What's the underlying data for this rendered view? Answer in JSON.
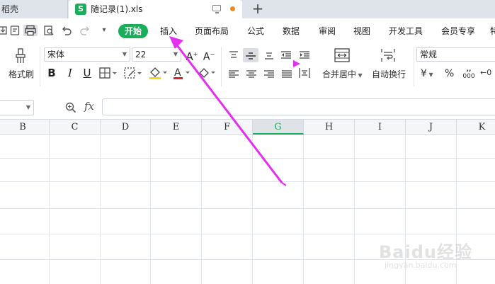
{
  "tabs": {
    "previous_label": "稻壳",
    "active_title": "随记录(1).xls",
    "logo_letter": "S",
    "new_tab_symbol": "+"
  },
  "menu": {
    "start": "开始",
    "items": [
      "插入",
      "页面布局",
      "公式",
      "数据",
      "审阅",
      "视图",
      "开发工具",
      "会员专享",
      "特"
    ]
  },
  "ribbon": {
    "format_painter": "格式刷",
    "font_name": "宋体",
    "font_size": "22",
    "bold": "B",
    "italic": "I",
    "underline": "U",
    "merge_center": "合并居中",
    "wrap_text": "自动换行",
    "number_format": "常规",
    "currency_symbol": "¥",
    "percent_symbol": "%",
    "thousands_symbol": "000",
    "decimal_symbol": "←0"
  },
  "formula_bar": {
    "fx": "fx"
  },
  "columns": {
    "labels": [
      "B",
      "C",
      "D",
      "E",
      "F",
      "G",
      "H",
      "I",
      "J",
      "K"
    ],
    "selected": "G"
  },
  "watermark": {
    "main": "Baidu经验",
    "sub": "jingyan.baidu.com"
  },
  "colors": {
    "accent": "#1aae5a",
    "arrow": "#e62ef0",
    "tab_bar": "#dfe3ea"
  }
}
